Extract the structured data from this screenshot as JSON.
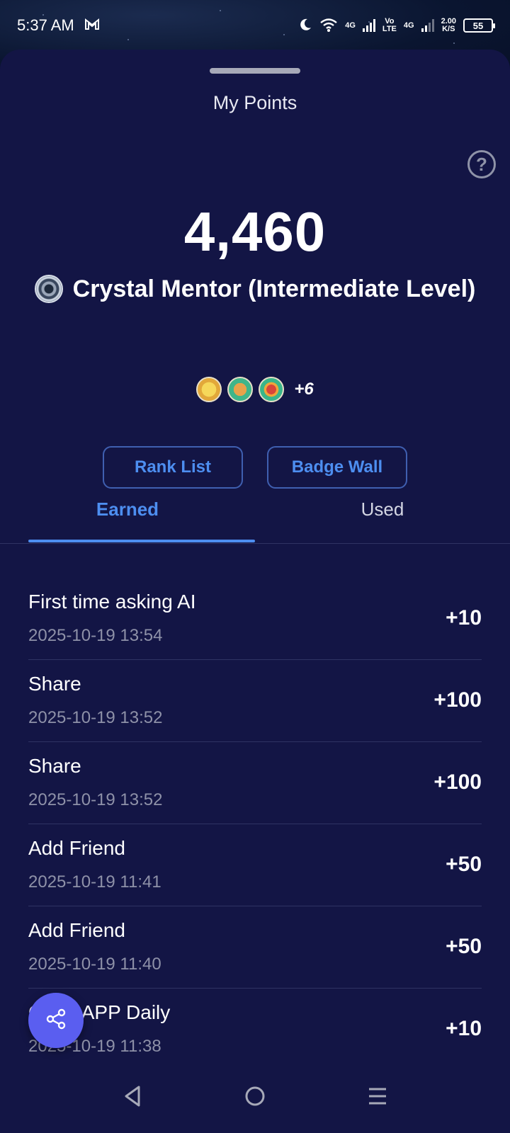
{
  "status_bar": {
    "time": "5:37 AM",
    "net_speed_value": "2.00",
    "net_speed_unit": "K/S",
    "battery": "55",
    "volte_top": "Vo",
    "volte_bottom": "LTE",
    "network1": "4G",
    "network2": "4G"
  },
  "header": {
    "title": "My Points"
  },
  "summary": {
    "points": "4,460",
    "level": "Crystal Mentor (Intermediate Level)",
    "badges_more": "+6"
  },
  "actions": {
    "rank_list": "Rank List",
    "badge_wall": "Badge Wall"
  },
  "tabs": [
    {
      "label": "Earned"
    },
    {
      "label": "Used"
    }
  ],
  "records": [
    {
      "title": "First time asking AI",
      "time": "2025-10-19 13:54",
      "points": "+10"
    },
    {
      "title": "Share",
      "time": "2025-10-19 13:52",
      "points": "+100"
    },
    {
      "title": "Share",
      "time": "2025-10-19 13:52",
      "points": "+100"
    },
    {
      "title": "Add Friend",
      "time": "2025-10-19 11:41",
      "points": "+50"
    },
    {
      "title": "Add Friend",
      "time": "2025-10-19 11:40",
      "points": "+50"
    },
    {
      "title": "Open APP Daily",
      "time": "2025-10-19 11:38",
      "points": "+10"
    }
  ],
  "colors": {
    "accent": "#4d8ef0",
    "sheet_bg": "#131545",
    "fab": "#5a5ef0"
  }
}
